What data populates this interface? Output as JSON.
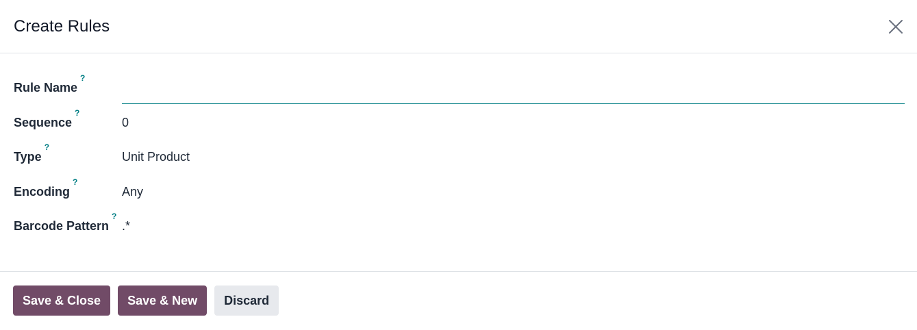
{
  "dialog": {
    "title": "Create Rules"
  },
  "form": {
    "help_marker": "?",
    "fields": {
      "rule_name": {
        "label": "Rule Name",
        "value": "",
        "placeholder": ""
      },
      "sequence": {
        "label": "Sequence",
        "value": "0"
      },
      "type": {
        "label": "Type",
        "value": "Unit Product"
      },
      "encoding": {
        "label": "Encoding",
        "value": "Any"
      },
      "barcode_pattern": {
        "label": "Barcode Pattern",
        "value": ".*"
      }
    }
  },
  "footer": {
    "save_close_label": "Save & Close",
    "save_new_label": "Save & New",
    "discard_label": "Discard"
  },
  "colors": {
    "primary": "#714b67",
    "accent": "#017e84",
    "secondary_button": "#e7e9ed"
  },
  "icons": {
    "close": "close-icon",
    "help": "help-icon"
  }
}
